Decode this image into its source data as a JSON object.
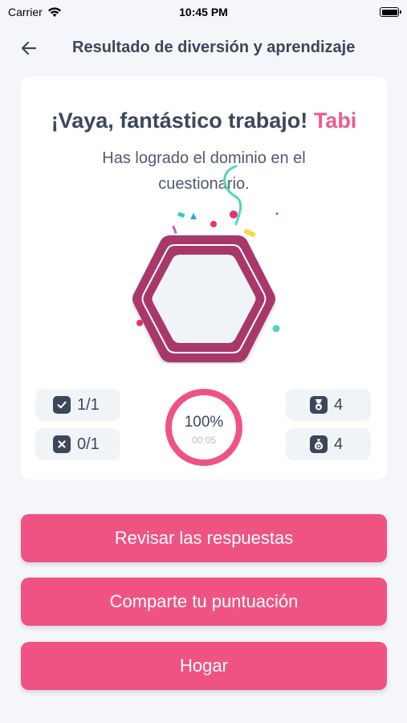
{
  "status_bar": {
    "carrier": "Carrier",
    "time": "10:45 PM"
  },
  "nav": {
    "title": "Resultado de diversión y aprendizaje"
  },
  "result": {
    "headline": "¡Vaya, fantástico trabajo!",
    "player_name": "Tabi",
    "subtitle": "Has logrado el dominio en el cuestionario.",
    "correct": "1/1",
    "wrong": "0/1",
    "score": "100%",
    "score_progress": 1.0,
    "time": "00:05",
    "medals": "4",
    "coins": "4"
  },
  "buttons": {
    "review": "Revisar las respuestas",
    "share": "Comparte tu puntuación",
    "home": "Hogar"
  },
  "colors": {
    "accent": "#ef5384",
    "badge": "#a8376a",
    "text": "#3c475b",
    "background": "#f4f6f9"
  },
  "icons": [
    "back-arrow-icon",
    "check-icon",
    "cross-icon",
    "medal-icon",
    "coin-bag-icon",
    "wifi-icon",
    "battery-icon"
  ]
}
